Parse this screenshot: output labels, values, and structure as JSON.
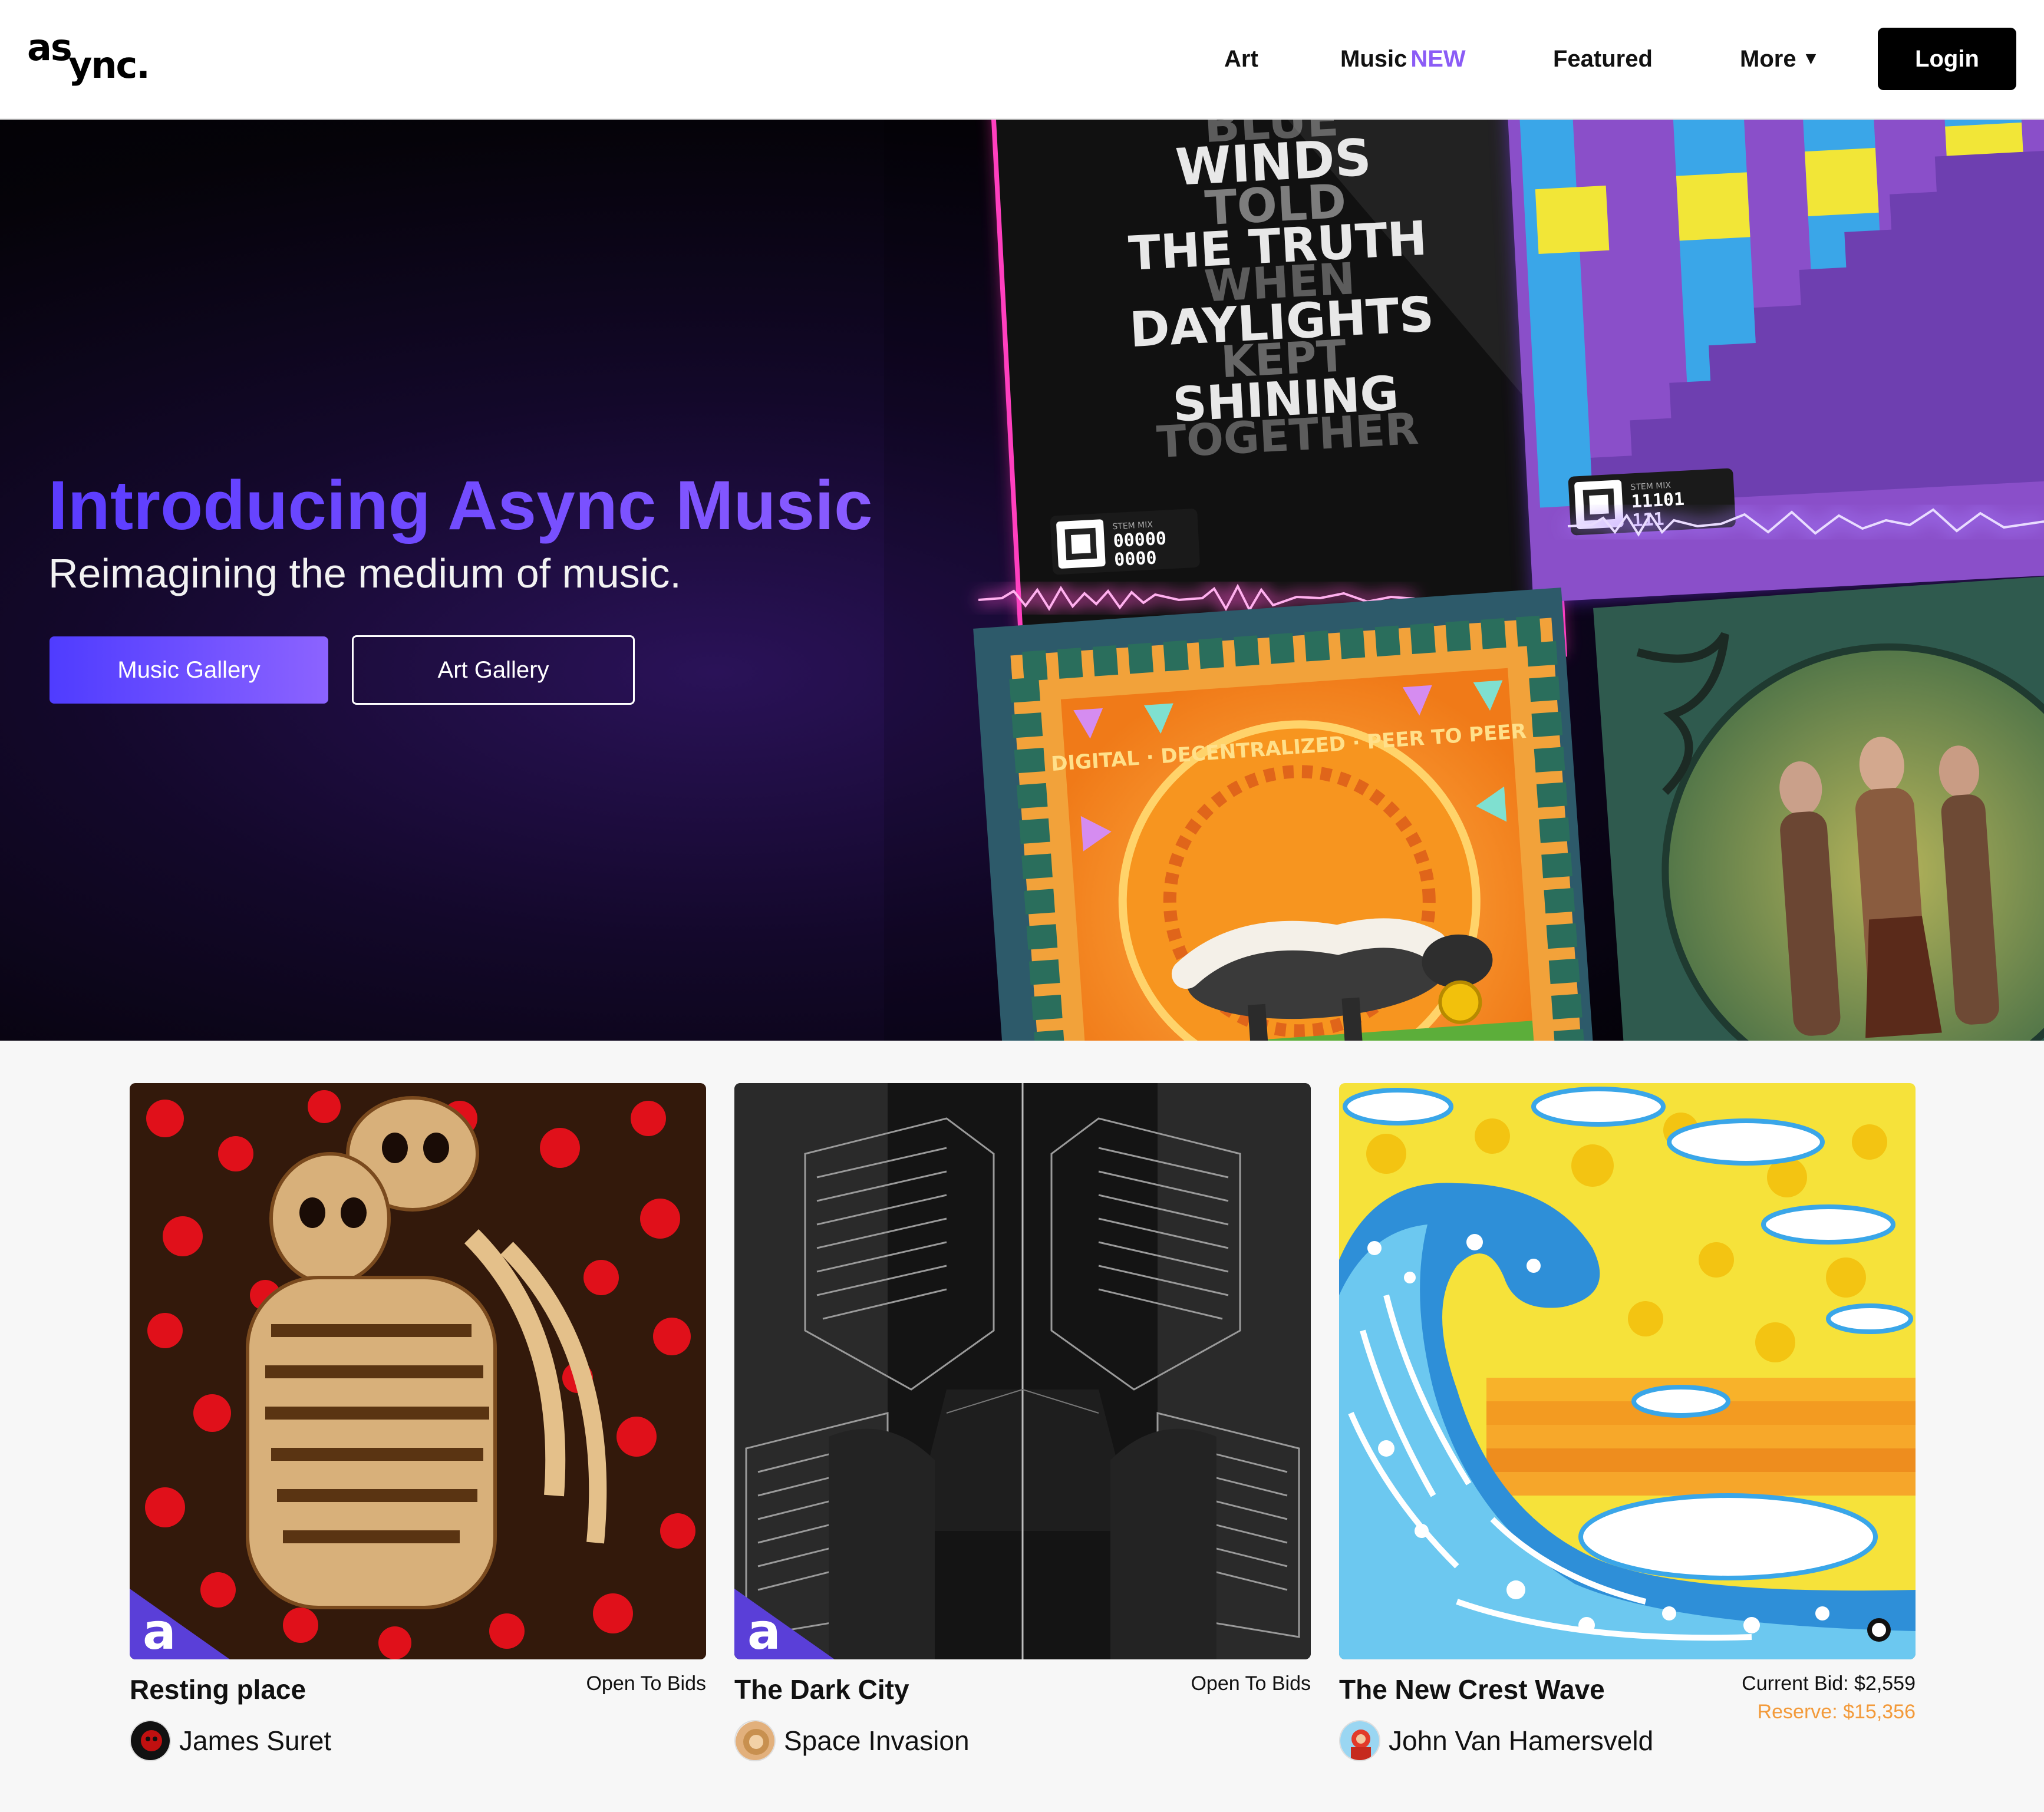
{
  "nav": {
    "logo_part1": "as",
    "logo_part2": "ync.",
    "items": [
      {
        "label": "Art"
      },
      {
        "label": "Music",
        "tag": "NEW"
      },
      {
        "label": "Featured"
      },
      {
        "label": "More",
        "icon": "caret-down-icon"
      }
    ],
    "login_label": "Login"
  },
  "hero": {
    "title": "Introducing Async Music",
    "subtitle": "Reimagining the medium of music.",
    "primary_button": "Music Gallery",
    "secondary_button": "Art Gallery",
    "cover_1": {
      "text_lines": [
        "BLUE",
        "WINDS",
        "TOLD",
        "THE TRUTH",
        "WHEN",
        "DAYLIGHTS",
        "KEPT",
        "SHINING",
        "TOGETHER"
      ],
      "stem_label": "STEM MIX",
      "stem_code_1": "00000",
      "stem_code_2": "0000"
    },
    "cover_2": {
      "stem_label": "STEM MIX",
      "stem_code_1": "11101",
      "stem_code_2": "111"
    },
    "cover_3": {
      "ring_text": "DIGITAL · DECENTRALIZED · PEER TO PEER"
    }
  },
  "cards": [
    {
      "title": "Resting place",
      "status": "Open To Bids",
      "artist": "James Suret",
      "badge": "a"
    },
    {
      "title": "The Dark City",
      "status": "Open To Bids",
      "artist": "Space Invasion",
      "badge": "a"
    },
    {
      "title": "The New Crest Wave",
      "status": "Current Bid: $2,559",
      "reserve": "Reserve: $15,356",
      "artist": "John Van Hamersveld"
    }
  ],
  "colors": {
    "accent_purple": "#6a45ff",
    "new_tag": "#8b5cf6",
    "reserve_orange": "#f39a3a",
    "button_dark": "#000000"
  }
}
